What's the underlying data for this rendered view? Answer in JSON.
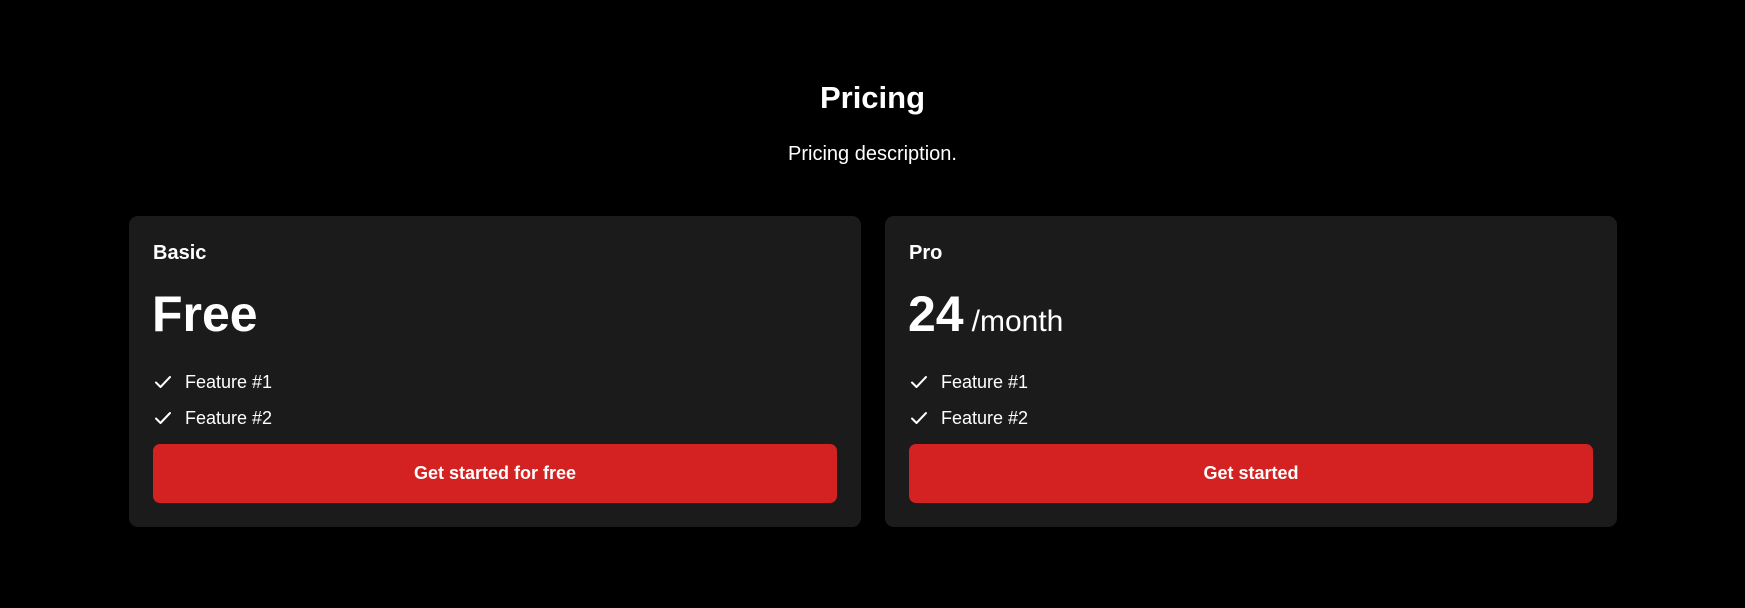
{
  "header": {
    "title": "Pricing",
    "description": "Pricing description."
  },
  "colors": {
    "background": "#000000",
    "card": "#1b1b1b",
    "accent": "#d42121",
    "text": "#ffffff"
  },
  "plans": [
    {
      "name": "Basic",
      "price": "Free",
      "period": "",
      "features": [
        {
          "icon": "check-icon",
          "label": "Feature #1"
        },
        {
          "icon": "check-icon",
          "label": "Feature #2"
        }
      ],
      "cta_label": "Get started for free"
    },
    {
      "name": "Pro",
      "price": "24",
      "period": "/month",
      "features": [
        {
          "icon": "check-icon",
          "label": "Feature #1"
        },
        {
          "icon": "check-icon",
          "label": "Feature #2"
        }
      ],
      "cta_label": "Get started"
    }
  ]
}
